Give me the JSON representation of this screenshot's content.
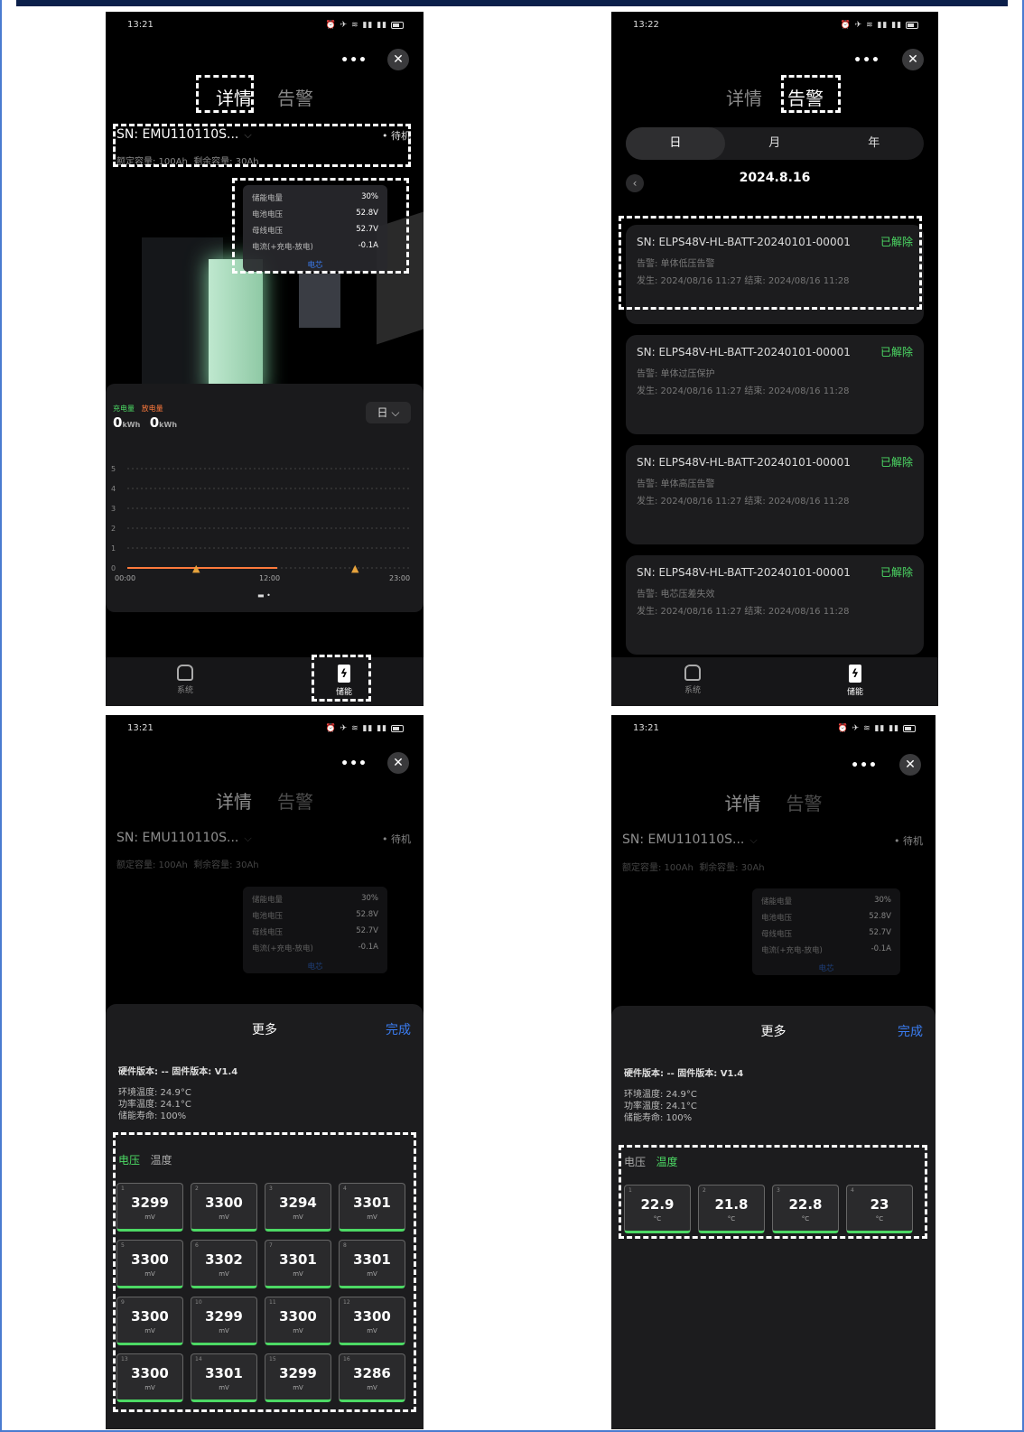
{
  "status": {
    "time_a": "13:21",
    "time_b": "13:22"
  },
  "tabs": {
    "details": "详情",
    "alarms": "告警"
  },
  "device": {
    "sn": "SN: EMU110110S...",
    "state": "• 待机",
    "rated": "额定容量: 100Ah",
    "remaining": "剩余容量: 30Ah"
  },
  "metrics": [
    {
      "label": "储能电量",
      "value": "30%"
    },
    {
      "label": "电池电压",
      "value": "52.8V"
    },
    {
      "label": "母线电压",
      "value": "52.7V"
    },
    {
      "label": "电流(+充电-放电)",
      "value": "-0.1A"
    }
  ],
  "metrics_link": "电芯",
  "energy": {
    "charge_label": "充电量",
    "discharge_label": "放电量",
    "charge_value": "0",
    "discharge_value": "0",
    "unit": "kWh",
    "period": "日"
  },
  "chart_data": {
    "type": "line",
    "x_ticks": [
      "00:00",
      "12:00",
      "23:00"
    ],
    "y_ticks": [
      "5",
      "4",
      "3",
      "2",
      "1",
      "0"
    ],
    "ylim": [
      0,
      5
    ],
    "series": [
      {
        "values": [
          0,
          0
        ]
      }
    ]
  },
  "nav": {
    "system": "系统",
    "storage": "储能"
  },
  "alarm_filter": {
    "day": "日",
    "month": "月",
    "year": "年",
    "date": "2024.8.16"
  },
  "alarms": [
    {
      "sn": "SN: ELPS48V-HL-BATT-20240101-00001",
      "status": "已解除",
      "type": "告警: 单体低压告警",
      "time": "发生: 2024/08/16 11:27   结束: 2024/08/16 11:28"
    },
    {
      "sn": "SN: ELPS48V-HL-BATT-20240101-00001",
      "status": "已解除",
      "type": "告警: 单体过压保护",
      "time": "发生: 2024/08/16 11:27   结束: 2024/08/16 11:28"
    },
    {
      "sn": "SN: ELPS48V-HL-BATT-20240101-00001",
      "status": "已解除",
      "type": "告警: 单体高压告警",
      "time": "发生: 2024/08/16 11:27   结束: 2024/08/16 11:28"
    },
    {
      "sn": "SN: ELPS48V-HL-BATT-20240101-00001",
      "status": "已解除",
      "type": "告警: 电芯压差失效",
      "time": "发生: 2024/08/16 11:27   结束: 2024/08/16 11:28"
    }
  ],
  "more": {
    "title": "更多",
    "done": "完成",
    "versions": "硬件版本: --   固件版本: V1.4",
    "env_temp": "环境温度: 24.9°C",
    "power_temp": "功率温度: 24.1°C",
    "life": "储能寿命: 100%",
    "voltage_tab": "电压",
    "temp_tab": "温度"
  },
  "voltages": {
    "unit": "mV",
    "cells": [
      "3299",
      "3300",
      "3294",
      "3301",
      "3300",
      "3302",
      "3301",
      "3301",
      "3300",
      "3299",
      "3300",
      "3300",
      "3300",
      "3301",
      "3299",
      "3286"
    ]
  },
  "temperatures": {
    "unit": "°C",
    "cells": [
      "22.9",
      "21.8",
      "22.8",
      "23"
    ]
  }
}
